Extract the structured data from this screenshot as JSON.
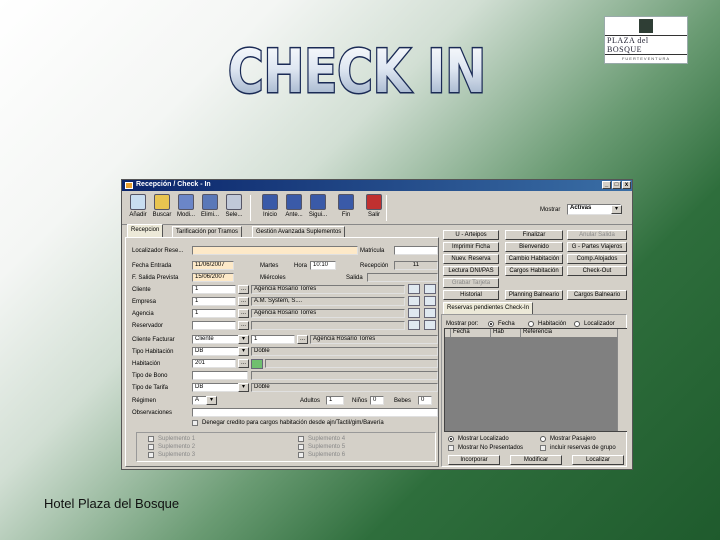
{
  "slide": {
    "title": "CHECK IN",
    "footer": "Hotel Plaza del Bosque",
    "logo": {
      "name": "PLAZA del BOSQUE",
      "sub": "FUERTEVENTURA"
    }
  },
  "window": {
    "title": "Recepción / Check - In",
    "controls": [
      "_",
      "□",
      "x"
    ]
  },
  "toolbar": {
    "buttons": [
      {
        "label": "Añadir",
        "icon": "add-icon",
        "color": "#c8ddf0"
      },
      {
        "label": "Buscar",
        "icon": "binoculars-icon",
        "color": "#e8c450"
      },
      {
        "label": "Modi...",
        "icon": "edit-icon",
        "color": "#6b86c8"
      },
      {
        "label": "Elimi...",
        "icon": "delete-icon",
        "color": "#5a78b8"
      },
      {
        "label": "Sele...",
        "icon": "select-icon",
        "color": "#c0c8d8"
      },
      {
        "label": "Inicio",
        "icon": "first-icon",
        "color": "#3a5aa8"
      },
      {
        "label": "Ante...",
        "icon": "previous-icon",
        "color": "#3a5aa8"
      },
      {
        "label": "Sigui...",
        "icon": "next-icon",
        "color": "#3a5aa8"
      },
      {
        "label": "Fin",
        "icon": "last-icon",
        "color": "#3a5aa8"
      },
      {
        "label": "Salir",
        "icon": "exit-icon",
        "color": "#c03030"
      }
    ],
    "mostrar_label": "Mostrar",
    "mostrar_value": "Activas"
  },
  "tabs": [
    "Recepcion",
    "Tarificación por Tramos",
    "Gestión Avanzada Suplementos"
  ],
  "form": {
    "localizador_label": "Localizador Rese...",
    "matricula_label": "Matricula",
    "fecha_entrada_label": "Fecha Entrada",
    "fecha_entrada": "11/06/2007",
    "martes": "Martes",
    "hora_label": "Hora",
    "hora": "10:10",
    "recepcion_label": "Recepción",
    "recepcion": "11",
    "fecha_salida_label": "F. Salida Prevista",
    "fecha_salida": "15/06/2007",
    "miercoles": "Miércoles",
    "salida_label": "Salida",
    "cliente_label": "Cliente",
    "cliente_code": "1",
    "cliente_name": "Agencia Rosario Torres",
    "empresa_label": "Empresa",
    "empresa_code": "1",
    "empresa_name": "A.M. System, S....",
    "agencia_label": "Agencia",
    "agencia_code": "1",
    "agencia_name": "Agencia Rosario Torres",
    "reservador_label": "Reservador",
    "cliente_facturar_label": "Cliente Facturar",
    "cliente_facturar": "Cliente",
    "facturar_code": "1",
    "facturar_name": "Agencia Rosario Torres",
    "tipo_hab_label": "Tipo Habitación",
    "tipo_hab": "DB",
    "tipo_hab_desc": "Doble",
    "habitacion_label": "Habitación",
    "habitacion": "201",
    "tipo_bono_label": "Tipo de Bono",
    "tipo_tarifa_label": "Tipo de Tarifa",
    "tipo_tarifa": "DB",
    "tipo_tarifa_desc": "Doble",
    "regimen_label": "Régimen",
    "regimen": "A",
    "adultos_label": "Adultos",
    "adultos": "1",
    "ninos_label": "Niños",
    "ninos": "0",
    "bebes_label": "Bebes",
    "bebes": "0",
    "observaciones_label": "Observaciones",
    "denegar_label": "Denegar credito para cargos habitación desde ajn/Tactil/gim/Bavería",
    "suplementos": [
      "Suplemento 1",
      "Suplemento 2",
      "Suplemento 3",
      "Suplemento 4",
      "Suplemento 5",
      "Suplemento 6"
    ]
  },
  "actions": {
    "buttons": [
      {
        "label": "U - Arteipos",
        "disabled": false
      },
      {
        "label": "Finalizar",
        "disabled": false
      },
      {
        "label": "Anular Salida",
        "disabled": true
      },
      {
        "label": "Imprimir Ficha",
        "disabled": false
      },
      {
        "label": "Bienvenido",
        "disabled": false
      },
      {
        "label": "G - Partes Viajeros",
        "disabled": false
      },
      {
        "label": "Nuev. Reserva",
        "disabled": false
      },
      {
        "label": "Cambio Habitación",
        "disabled": false
      },
      {
        "label": "Comp.Alojados",
        "disabled": false
      },
      {
        "label": "Lectura DNI/PAS",
        "disabled": false
      },
      {
        "label": "Cargos Habitación",
        "disabled": false
      },
      {
        "label": "Check-Out",
        "disabled": false
      }
    ],
    "grabar_tarjeta": "Grabar Tarjeta",
    "historial": "Historial",
    "planning": "Planning Balneario",
    "cargos_balneario": "Cargos Balneario"
  },
  "pending": {
    "tab": "Reservas pendientes Check-In",
    "mostrar_por": "Mostrar por:",
    "radios": [
      "Fecha",
      "Habitación",
      "Localizador"
    ],
    "columns": [
      "Fecha",
      "Hab",
      "Referencia"
    ],
    "opt_localizado": "Mostrar Localizado",
    "opt_pasajero": "Mostrar Pasajero",
    "opt_no_presentados": "Mostrar No Presentados",
    "opt_incluir": "incluir reservas de grupo",
    "incorporar": "Incorporar",
    "modificar": "Modificar",
    "localizar": "Localizar"
  }
}
